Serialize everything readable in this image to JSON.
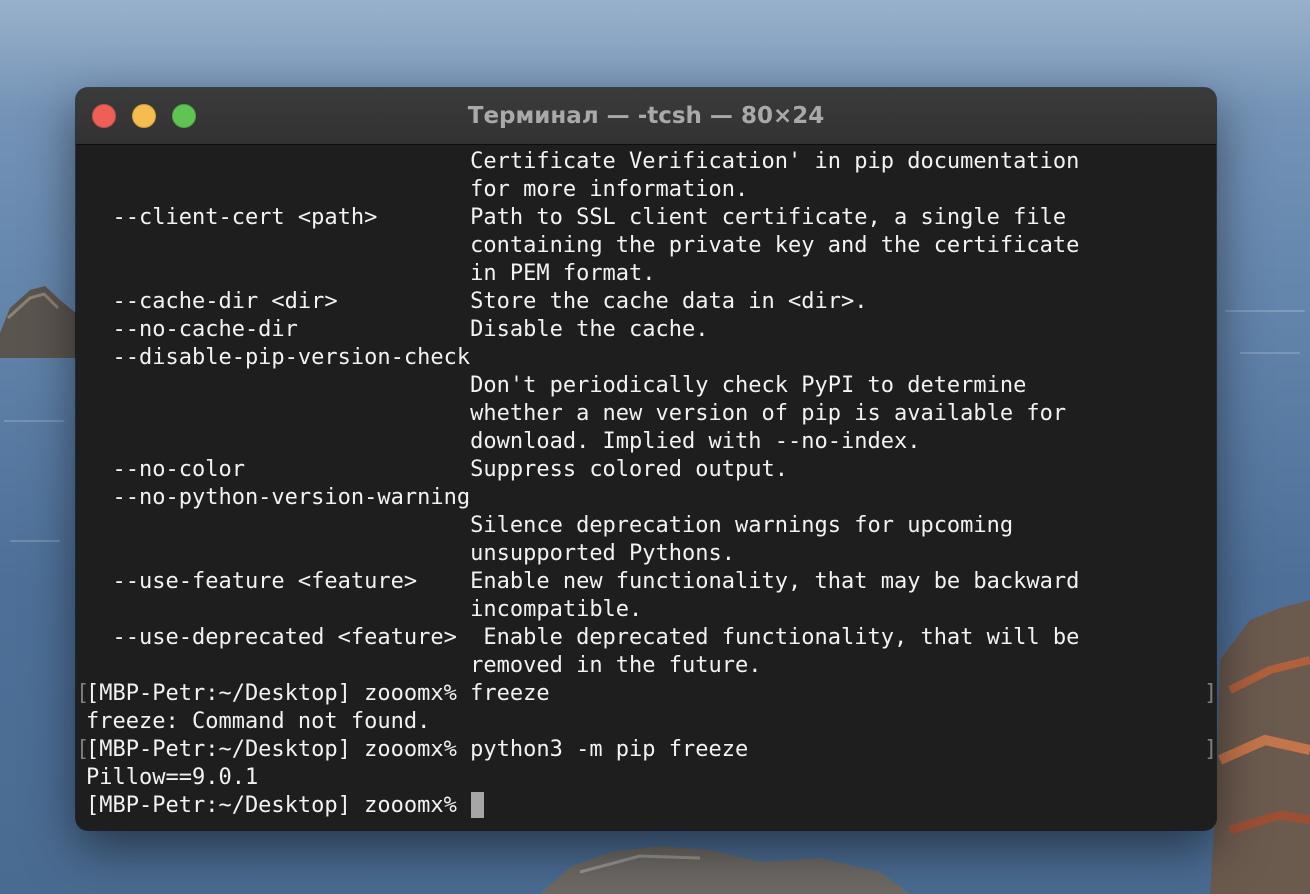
{
  "window": {
    "title": "Терминал — -tcsh — 80×24"
  },
  "terminal": {
    "lines": [
      "                             Certificate Verification' in pip documentation",
      "                             for more information.",
      "  --client-cert <path>       Path to SSL client certificate, a single file",
      "                             containing the private key and the certificate",
      "                             in PEM format.",
      "  --cache-dir <dir>          Store the cache data in <dir>.",
      "  --no-cache-dir             Disable the cache.",
      "  --disable-pip-version-check",
      "                             Don't periodically check PyPI to determine",
      "                             whether a new version of pip is available for",
      "                             download. Implied with --no-index.",
      "  --no-color                 Suppress colored output.",
      "  --no-python-version-warning",
      "                             Silence deprecation warnings for upcoming",
      "                             unsupported Pythons.",
      "  --use-feature <feature>    Enable new functionality, that may be backward",
      "                             incompatible.",
      "  --use-deprecated <feature>  Enable deprecated functionality, that will be",
      "                             removed in the future.",
      "[MBP-Petr:~/Desktop] zooomx% freeze",
      "freeze: Command not found.",
      "[MBP-Petr:~/Desktop] zooomx% python3 -m pip freeze",
      "Pillow==9.0.1",
      "[MBP-Petr:~/Desktop] zooomx% "
    ],
    "mark_open": "[",
    "mark_close": "]"
  },
  "colors": {
    "close": "#ee5f58",
    "minimize": "#f5bd4f",
    "maximize": "#5fc452",
    "terminal_bg": "#1e1e1e",
    "terminal_fg": "#f2f2f2"
  },
  "icons": {
    "close": "close-icon",
    "minimize": "minimize-icon",
    "maximize": "maximize-icon"
  }
}
